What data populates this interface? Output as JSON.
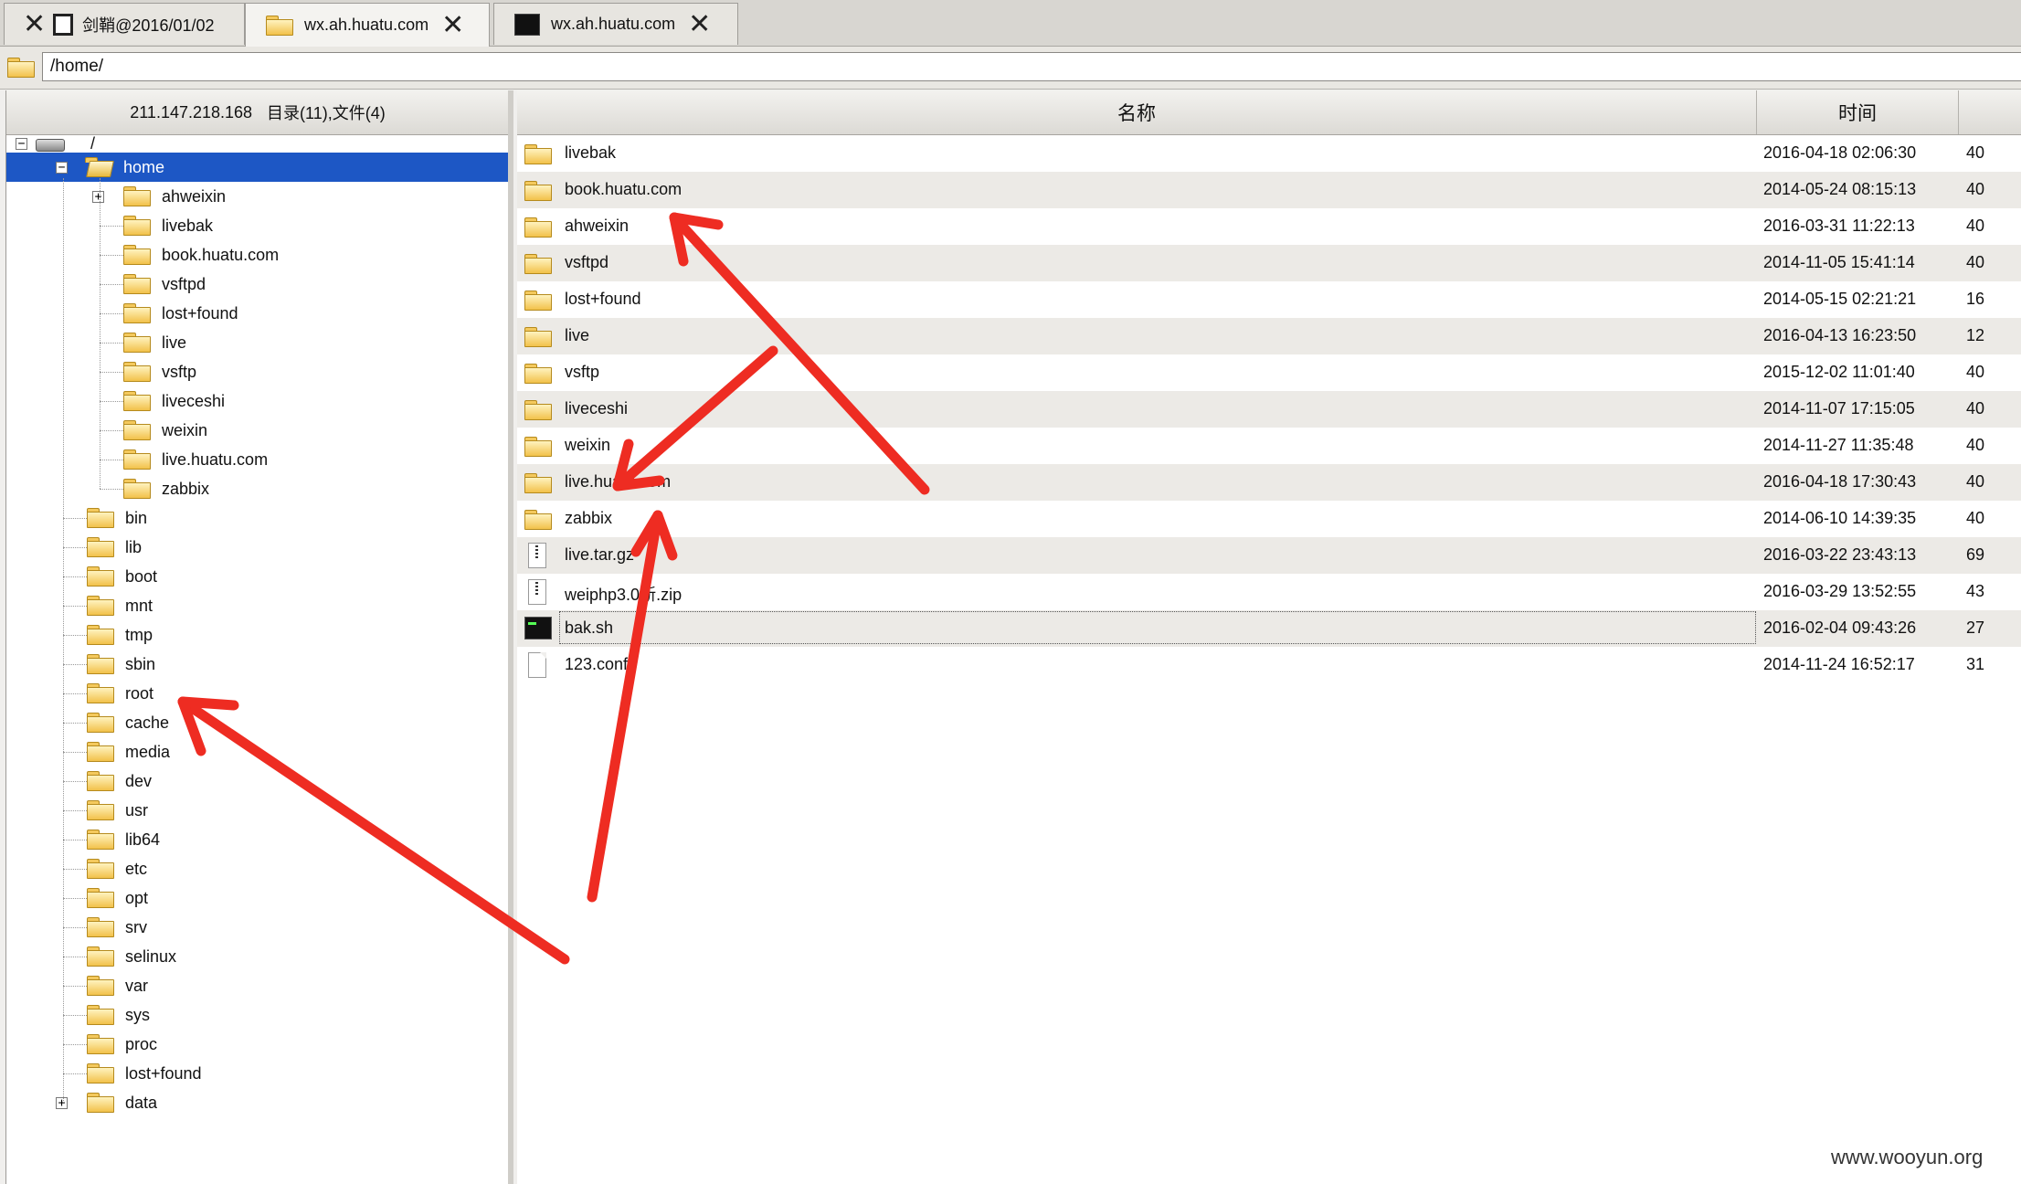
{
  "tabs": [
    {
      "label": "剑鞘@2016/01/02",
      "active": false
    },
    {
      "label": "wx.ah.huatu.com",
      "active": true
    },
    {
      "label": "wx.ah.huatu.com",
      "active": false
    }
  ],
  "address": {
    "value": "/home/"
  },
  "tree": {
    "header_ip": "211.147.218.168",
    "header_counts": "目录(11),文件(4)",
    "root_label": "/",
    "selected": "home",
    "home_children": [
      "ahweixin",
      "livebak",
      "book.huatu.com",
      "vsftpd",
      "lost+found",
      "live",
      "vsftp",
      "liveceshi",
      "weixin",
      "live.huatu.com",
      "zabbix"
    ],
    "root_children": [
      "bin",
      "lib",
      "boot",
      "mnt",
      "tmp",
      "sbin",
      "root",
      "cache",
      "media",
      "dev",
      "usr",
      "lib64",
      "etc",
      "opt",
      "srv",
      "selinux",
      "var",
      "sys",
      "proc",
      "lost+found",
      "data"
    ]
  },
  "list": {
    "columns": {
      "name": "名称",
      "time": "时间"
    },
    "rows": [
      {
        "name": "livebak",
        "time": "2016-04-18 02:06:30",
        "size": "40",
        "icon": "folder-icon"
      },
      {
        "name": "book.huatu.com",
        "time": "2014-05-24 08:15:13",
        "size": "40",
        "icon": "folder-icon"
      },
      {
        "name": "ahweixin",
        "time": "2016-03-31 11:22:13",
        "size": "40",
        "icon": "folder-icon"
      },
      {
        "name": "vsftpd",
        "time": "2014-11-05 15:41:14",
        "size": "40",
        "icon": "folder-icon"
      },
      {
        "name": "lost+found",
        "time": "2014-05-15 02:21:21",
        "size": "16",
        "icon": "folder-icon"
      },
      {
        "name": "live",
        "time": "2016-04-13 16:23:50",
        "size": "12",
        "icon": "folder-icon"
      },
      {
        "name": "vsftp",
        "time": "2015-12-02 11:01:40",
        "size": "40",
        "icon": "folder-icon"
      },
      {
        "name": "liveceshi",
        "time": "2014-11-07 17:15:05",
        "size": "40",
        "icon": "folder-icon"
      },
      {
        "name": "weixin",
        "time": "2014-11-27 11:35:48",
        "size": "40",
        "icon": "folder-icon"
      },
      {
        "name": "live.huatu.com",
        "time": "2016-04-18 17:30:43",
        "size": "40",
        "icon": "folder-icon"
      },
      {
        "name": "zabbix",
        "time": "2014-06-10 14:39:35",
        "size": "40",
        "icon": "folder-icon"
      },
      {
        "name": "live.tar.gz",
        "time": "2016-03-22 23:43:13",
        "size": "69",
        "icon": "archive-file-icon"
      },
      {
        "name": "weiphp3.0新.zip",
        "time": "2016-03-29 13:52:55",
        "size": "43",
        "icon": "archive-file-icon"
      },
      {
        "name": "bak.sh",
        "time": "2016-02-04 09:43:26",
        "size": "27",
        "icon": "terminal-file-icon"
      },
      {
        "name": "123.conf",
        "time": "2014-11-24 16:52:17",
        "size": "31",
        "icon": "file-icon"
      }
    ]
  },
  "watermark": "www.wooyun.org",
  "colors": {
    "selection": "#1d57c5",
    "arrow": "#ee2c22"
  }
}
